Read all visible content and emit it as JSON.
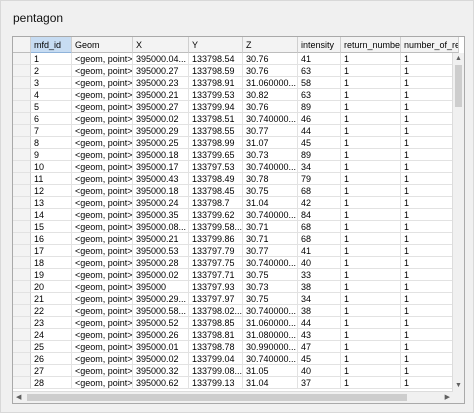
{
  "window": {
    "title": "pentagon"
  },
  "columns": [
    "mfd_id",
    "Geom",
    "X",
    "Y",
    "Z",
    "intensity",
    "return_number",
    "number_of_retu"
  ],
  "rows": [
    [
      "1",
      "<geom, point>",
      "395000.04...",
      "133798.54",
      "30.76",
      "41",
      "1",
      "1"
    ],
    [
      "2",
      "<geom, point>",
      "395000.27",
      "133798.59",
      "30.76",
      "63",
      "1",
      "1"
    ],
    [
      "3",
      "<geom, point>",
      "395000.23",
      "133798.91",
      "31.060000...",
      "58",
      "1",
      "1"
    ],
    [
      "4",
      "<geom, point>",
      "395000.21",
      "133799.53",
      "30.82",
      "63",
      "1",
      "1"
    ],
    [
      "5",
      "<geom, point>",
      "395000.27",
      "133799.94",
      "30.76",
      "89",
      "1",
      "1"
    ],
    [
      "6",
      "<geom, point>",
      "395000.02",
      "133798.51",
      "30.740000...",
      "46",
      "1",
      "1"
    ],
    [
      "7",
      "<geom, point>",
      "395000.29",
      "133798.55",
      "30.77",
      "44",
      "1",
      "1"
    ],
    [
      "8",
      "<geom, point>",
      "395000.25",
      "133798.99",
      "31.07",
      "45",
      "1",
      "1"
    ],
    [
      "9",
      "<geom, point>",
      "395000.18",
      "133799.65",
      "30.73",
      "89",
      "1",
      "1"
    ],
    [
      "10",
      "<geom, point>",
      "395000.17",
      "133797.53",
      "30.740000...",
      "34",
      "1",
      "1"
    ],
    [
      "11",
      "<geom, point>",
      "395000.43",
      "133798.49",
      "30.78",
      "79",
      "1",
      "1"
    ],
    [
      "12",
      "<geom, point>",
      "395000.18",
      "133798.45",
      "30.75",
      "68",
      "1",
      "1"
    ],
    [
      "13",
      "<geom, point>",
      "395000.24",
      "133798.7",
      "31.04",
      "42",
      "1",
      "1"
    ],
    [
      "14",
      "<geom, point>",
      "395000.35",
      "133799.62",
      "30.740000...",
      "84",
      "1",
      "1"
    ],
    [
      "15",
      "<geom, point>",
      "395000.08...",
      "133799.58...",
      "30.71",
      "68",
      "1",
      "1"
    ],
    [
      "16",
      "<geom, point>",
      "395000.21",
      "133799.86",
      "30.71",
      "68",
      "1",
      "1"
    ],
    [
      "17",
      "<geom, point>",
      "395000.53",
      "133797.79",
      "30.77",
      "41",
      "1",
      "1"
    ],
    [
      "18",
      "<geom, point>",
      "395000.28",
      "133797.75",
      "30.740000...",
      "40",
      "1",
      "1"
    ],
    [
      "19",
      "<geom, point>",
      "395000.02",
      "133797.71",
      "30.75",
      "33",
      "1",
      "1"
    ],
    [
      "20",
      "<geom, point>",
      "395000",
      "133797.93",
      "30.73",
      "38",
      "1",
      "1"
    ],
    [
      "21",
      "<geom, point>",
      "395000.29...",
      "133797.97",
      "30.75",
      "34",
      "1",
      "1"
    ],
    [
      "22",
      "<geom, point>",
      "395000.58...",
      "133798.02...",
      "30.740000...",
      "38",
      "1",
      "1"
    ],
    [
      "23",
      "<geom, point>",
      "395000.52",
      "133798.85",
      "31.060000...",
      "44",
      "1",
      "1"
    ],
    [
      "24",
      "<geom, point>",
      "395000.26",
      "133798.81",
      "31.080000...",
      "43",
      "1",
      "1"
    ],
    [
      "25",
      "<geom, point>",
      "395000.01",
      "133798.78",
      "30.990000...",
      "47",
      "1",
      "1"
    ],
    [
      "26",
      "<geom, point>",
      "395000.02",
      "133799.04",
      "30.740000...",
      "45",
      "1",
      "1"
    ],
    [
      "27",
      "<geom, point>",
      "395000.32",
      "133799.08...",
      "31.05",
      "40",
      "1",
      "1"
    ],
    [
      "28",
      "<geom, point>",
      "395000.62",
      "133799.13",
      "31.04",
      "37",
      "1",
      "1"
    ]
  ]
}
